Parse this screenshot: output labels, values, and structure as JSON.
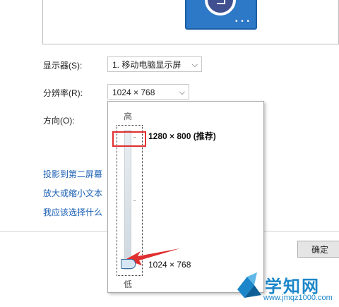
{
  "display_row": {
    "label": "显示器(S):",
    "value": "1. 移动电脑显示屏"
  },
  "resolution_row": {
    "label": "分辨率(R):",
    "value": "1024 × 768"
  },
  "orientation_row": {
    "label": "方向(O):"
  },
  "links": [
    "投影到第二屏幕",
    "放大或缩小文本",
    "我应该选择什么"
  ],
  "ok_button": "确定",
  "resolution_popup": {
    "high_label": "高",
    "low_label": "低",
    "recommended": "1280 × 800 (推荐)",
    "current": "1024 × 768",
    "slider_level": 0.0
  },
  "watermark": {
    "title": "学知网",
    "url": "www.jmqz1000.com"
  },
  "colors": {
    "highlight_red": "#e02f2f",
    "monitor_blue": "#2d79c7",
    "link_blue": "#1a5fb4"
  }
}
